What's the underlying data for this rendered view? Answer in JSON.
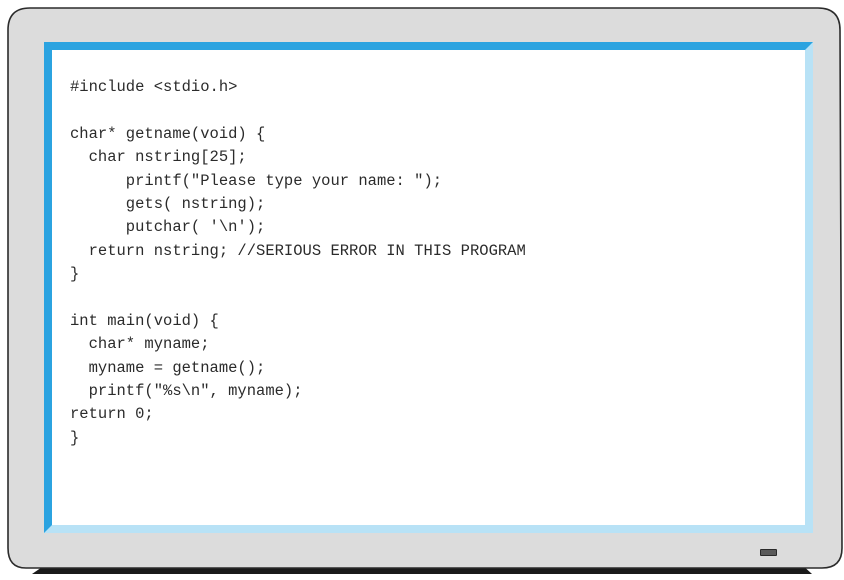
{
  "code": {
    "lines": [
      "#include <stdio.h>",
      "",
      "char* getname(void) {",
      "  char nstring[25];",
      "      printf(\"Please type your name: \");",
      "      gets( nstring);",
      "      putchar( '\\n');",
      "  return nstring; //SERIOUS ERROR IN THIS PROGRAM",
      "}",
      "",
      "int main(void) {",
      "  char* myname;",
      "  myname = getname();",
      "  printf(\"%s\\n\", myname);",
      "return 0;",
      "}"
    ]
  },
  "colors": {
    "bezel": "#dcdcdc",
    "bezel_outline": "#2b2b2b",
    "screen_border_accent": "#2ba3e0",
    "screen_border_light": "#b8e2f6",
    "screen_background": "#ffffff",
    "code_text": "#2b2b2b",
    "stand": "#1a1a1a"
  }
}
